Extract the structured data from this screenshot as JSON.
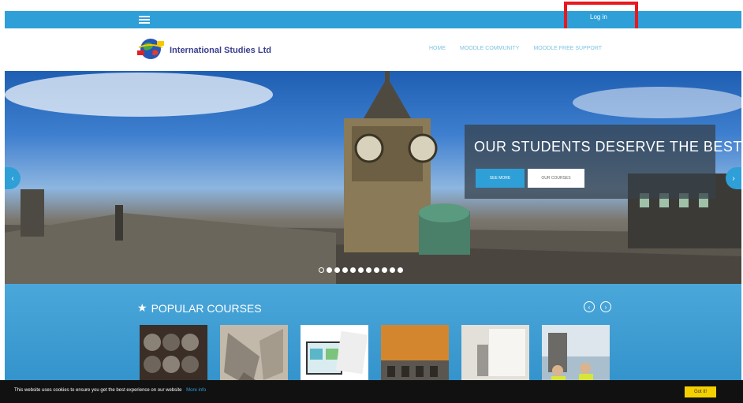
{
  "topbar": {
    "login_label": "Log in"
  },
  "header": {
    "brand": "International Studies Ltd",
    "nav": [
      "HOME",
      "MOODLE COMMUNITY",
      "MOODLE FREE SUPPORT"
    ]
  },
  "hero": {
    "caption_title": "OUR STUDENTS DESERVE THE BEST!",
    "see_more_label": "SEE MORE",
    "our_courses_label": "OUR COURSES",
    "slide_count": 11,
    "active_slide": 1
  },
  "courses": {
    "title": "POPULAR COURSES"
  },
  "cookie": {
    "text": "This website uses cookies to ensure you get the best experience on our website",
    "more_info": "More info",
    "got_it": "Got it!"
  },
  "colors": {
    "accent": "#2f9fd8",
    "highlight": "#e8181e",
    "cookie_button": "#f5d000"
  }
}
